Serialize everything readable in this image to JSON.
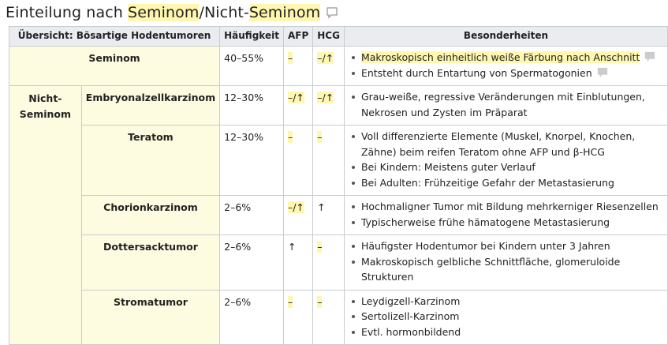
{
  "title": {
    "prefix": "Einteilung nach ",
    "highlight1": "Seminom",
    "middle": "/Nicht-",
    "highlight2": "Seminom"
  },
  "table": {
    "headers": {
      "overview": "Übersicht: Bösartige Hodentumoren",
      "frequency": "Häufigkeit",
      "afp": "AFP",
      "hcg": "HCG",
      "special": "Besonderheiten"
    },
    "seminom": {
      "name": "Seminom",
      "freq": "40–55%",
      "afp": "–",
      "hcg": "–/↑",
      "notes": [
        "Makroskopisch einheitlich weiße Färbung nach Anschnitt",
        "Entsteht durch Entartung von Spermatogonien"
      ]
    },
    "group_label_line1": "Nicht-",
    "group_label_line2": "Seminom",
    "rows": [
      {
        "name": "Embryonalzellkarzinom",
        "freq": "12–30%",
        "afp": "–/↑",
        "hcg": "–/↑",
        "notes": [
          "Grau-weiße, regressive Veränderungen mit Einblutungen, Nekrosen und Zysten im Präparat"
        ]
      },
      {
        "name": "Teratom",
        "freq": "12–30%",
        "afp": "–",
        "hcg": "–",
        "notes": [
          "Voll differenzierte Elemente (Muskel, Knorpel, Knochen, Zähne) beim reifen Teratom ohne AFP und β-HCG",
          "Bei Kindern: Meistens guter Verlauf",
          "Bei Adulten: Frühzeitige Gefahr der Metastasierung"
        ]
      },
      {
        "name": "Chorionkarzinom",
        "freq": "2–6%",
        "afp": "–/↑",
        "hcg": "↑",
        "notes": [
          "Hochmaligner Tumor mit Bildung mehrkerniger Riesenzellen",
          "Typischerweise frühe hämatogene Metastasierung"
        ]
      },
      {
        "name": "Dottersacktumor",
        "freq": "2–6%",
        "afp": "↑",
        "hcg": "–",
        "notes": [
          "Häufigster Hodentumor bei Kindern unter 3 Jahren",
          "Makroskopisch gelbliche Schnittfläche, glomeruloide Strukturen"
        ]
      },
      {
        "name": "Stromatumor",
        "freq": "2–6%",
        "afp": "–",
        "hcg": "–",
        "notes": [
          "Leydigzell-Karzinom",
          "Sertolizell-Karzinom",
          "Evtl. hormonbildend"
        ]
      }
    ]
  },
  "icons": {
    "heading_comment": "speech-bubble-icon",
    "row_comment": "comment-icon"
  }
}
